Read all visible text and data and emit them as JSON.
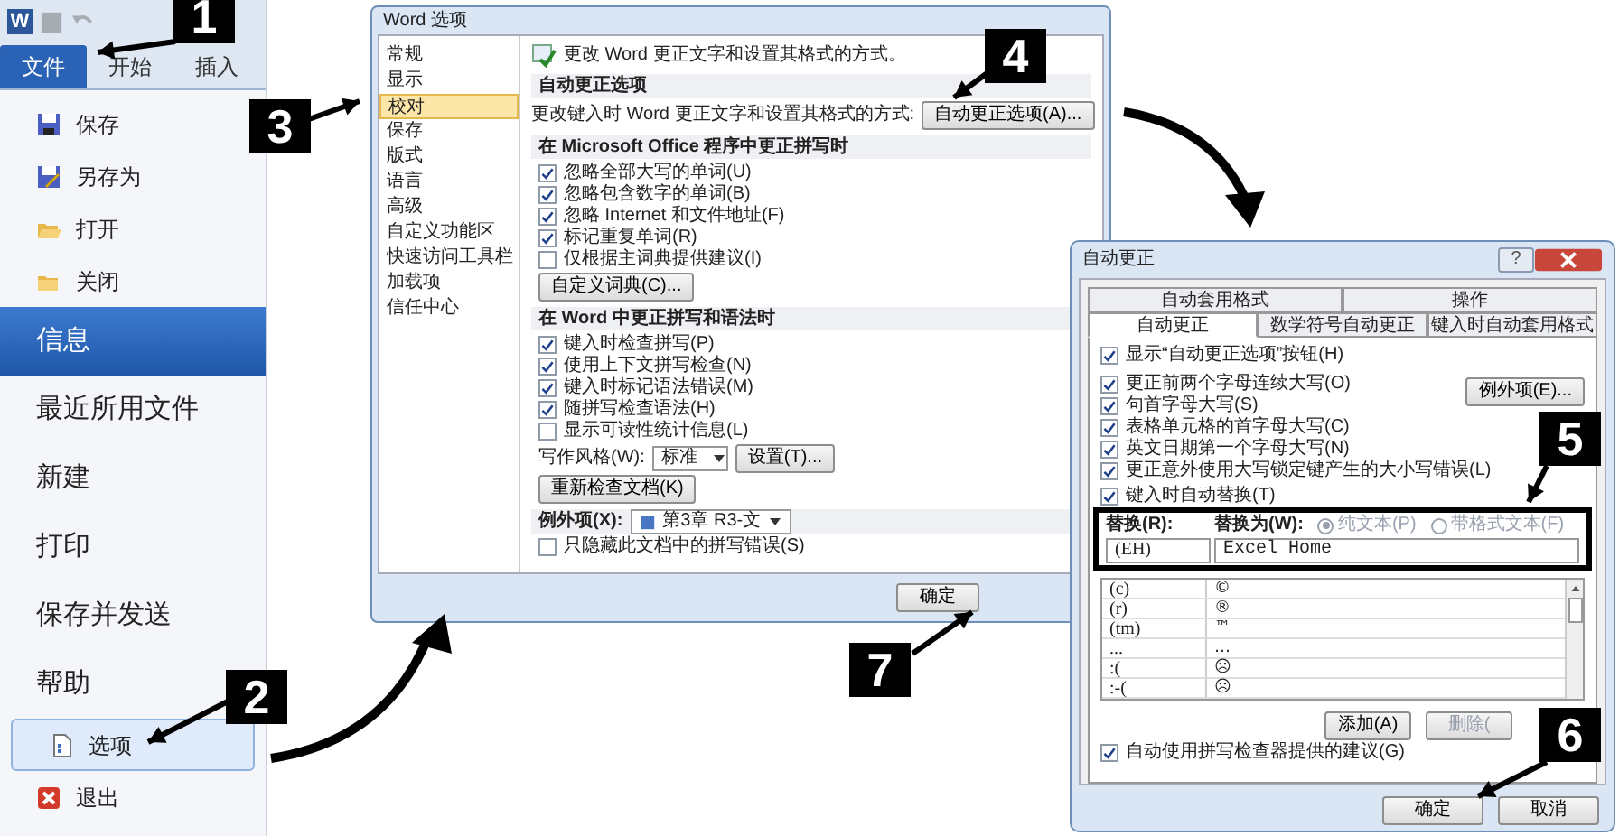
{
  "word_window": {
    "logo": "W",
    "tabs": [
      {
        "label": "文件",
        "selected": true
      },
      {
        "label": "开始",
        "selected": false
      },
      {
        "label": "插入",
        "selected": false
      }
    ],
    "menu": [
      {
        "label": "保存",
        "kind": "save",
        "selected": false,
        "hovered": false
      },
      {
        "label": "另存为",
        "kind": "saveas",
        "selected": false,
        "hovered": false
      },
      {
        "label": "打开",
        "kind": "open",
        "selected": false,
        "hovered": false
      },
      {
        "label": "关闭",
        "kind": "close",
        "selected": false,
        "hovered": false
      },
      {
        "label": "信息",
        "kind": "page",
        "selected": true,
        "hovered": false
      },
      {
        "label": "最近所用文件",
        "kind": "page",
        "selected": false,
        "hovered": false
      },
      {
        "label": "新建",
        "kind": "page",
        "selected": false,
        "hovered": false
      },
      {
        "label": "打印",
        "kind": "page",
        "selected": false,
        "hovered": false
      },
      {
        "label": "保存并发送",
        "kind": "page",
        "selected": false,
        "hovered": false
      },
      {
        "label": "帮助",
        "kind": "page",
        "selected": false,
        "hovered": false
      },
      {
        "label": "选项",
        "kind": "options",
        "selected": false,
        "hovered": true
      },
      {
        "label": "退出",
        "kind": "exit",
        "selected": false,
        "hovered": false
      }
    ]
  },
  "options_dialog": {
    "title": "Word 选项",
    "nav": [
      {
        "label": "常规",
        "selected": false
      },
      {
        "label": "显示",
        "selected": false
      },
      {
        "label": "校对",
        "selected": true
      },
      {
        "label": "保存",
        "selected": false
      },
      {
        "label": "版式",
        "selected": false
      },
      {
        "label": "语言",
        "selected": false
      },
      {
        "label": "高级",
        "selected": false
      },
      {
        "label": "自定义功能区",
        "selected": false
      },
      {
        "label": "快速访问工具栏",
        "selected": false
      },
      {
        "label": "加载项",
        "selected": false
      },
      {
        "label": "信任中心",
        "selected": false
      }
    ],
    "header": "更改 Word 更正文字和设置其格式的方式。",
    "autocorrect_section": {
      "title": "自动更正选项",
      "label": "更改键入时 Word 更正文字和设置其格式的方式:",
      "button": "自动更正选项(A)..."
    },
    "office_section": {
      "title": "在 Microsoft Office 程序中更正拼写时",
      "options": [
        {
          "label": "忽略全部大写的单词(U)",
          "checked": true
        },
        {
          "label": "忽略包含数字的单词(B)",
          "checked": true
        },
        {
          "label": "忽略 Internet 和文件地址(F)",
          "checked": true
        },
        {
          "label": "标记重复单词(R)",
          "checked": true
        },
        {
          "label": "仅根据主词典提供建议(I)",
          "checked": false
        }
      ],
      "button": "自定义词典(C)..."
    },
    "word_section": {
      "title": "在 Word 中更正拼写和语法时",
      "options": [
        {
          "label": "键入时检查拼写(P)",
          "checked": true
        },
        {
          "label": "使用上下文拼写检查(N)",
          "checked": true
        },
        {
          "label": "键入时标记语法错误(M)",
          "checked": true
        },
        {
          "label": "随拼写检查语法(H)",
          "checked": true
        },
        {
          "label": "显示可读性统计信息(L)",
          "checked": false
        }
      ],
      "style_label": "写作风格(W):",
      "style_value": "标准",
      "settings_button": "设置(T)...",
      "recheck_button": "重新检查文档(K)"
    },
    "exceptions": {
      "label": "例外项(X):",
      "value": "第3章 R3-文",
      "option": {
        "label": "只隐藏此文档中的拼写错误(S)",
        "checked": false
      }
    },
    "ok_button": "确定"
  },
  "autocorrect_dialog": {
    "title": "自动更正",
    "help": "?",
    "tabs_back": [
      {
        "label": "自动套用格式",
        "selected": false
      },
      {
        "label": "操作",
        "selected": false
      }
    ],
    "tabs_front": [
      {
        "label": "自动更正",
        "selected": true
      },
      {
        "label": "数学符号自动更正",
        "selected": false
      },
      {
        "label": "键入时自动套用格式",
        "selected": false
      }
    ],
    "show_button_option": {
      "label": "显示“自动更正选项”按钮(H)",
      "checked": true
    },
    "options": [
      {
        "label": "更正前两个字母连续大写(O)",
        "checked": true
      },
      {
        "label": "句首字母大写(S)",
        "checked": true
      },
      {
        "label": "表格单元格的首字母大写(C)",
        "checked": true
      },
      {
        "label": "英文日期第一个字母大写(N)",
        "checked": true
      },
      {
        "label": "更正意外使用大写锁定键产生的大小写错误(L)",
        "checked": true
      }
    ],
    "exceptions_button": "例外项(E)...",
    "replace_option": {
      "label": "键入时自动替换(T)",
      "checked": true
    },
    "replace_label": "替换(R):",
    "with_label": "替换为(W):",
    "radios": [
      {
        "label": "纯文本(P)",
        "selected": true
      },
      {
        "label": "带格式文本(F)",
        "selected": false
      }
    ],
    "replace_value": "(EH)",
    "with_value": "Excel Home",
    "entries": [
      {
        "from": "(c)",
        "to": "©"
      },
      {
        "from": "(r)",
        "to": "®"
      },
      {
        "from": "(tm)",
        "to": "™"
      },
      {
        "from": "...",
        "to": "…"
      },
      {
        "from": ":(",
        "to": "☹"
      },
      {
        "from": ":-(",
        "to": "☹"
      }
    ],
    "add_button": "添加(A)",
    "delete_button": "删除(",
    "suggest_option": {
      "label": "自动使用拼写检查器提供的建议(G)",
      "checked": true
    },
    "ok_button": "确定",
    "cancel_button": "取消"
  },
  "steps": [
    {
      "label": "1"
    },
    {
      "label": "2"
    },
    {
      "label": "3"
    },
    {
      "label": "4"
    },
    {
      "label": "5"
    },
    {
      "label": "6"
    },
    {
      "label": "7"
    }
  ]
}
